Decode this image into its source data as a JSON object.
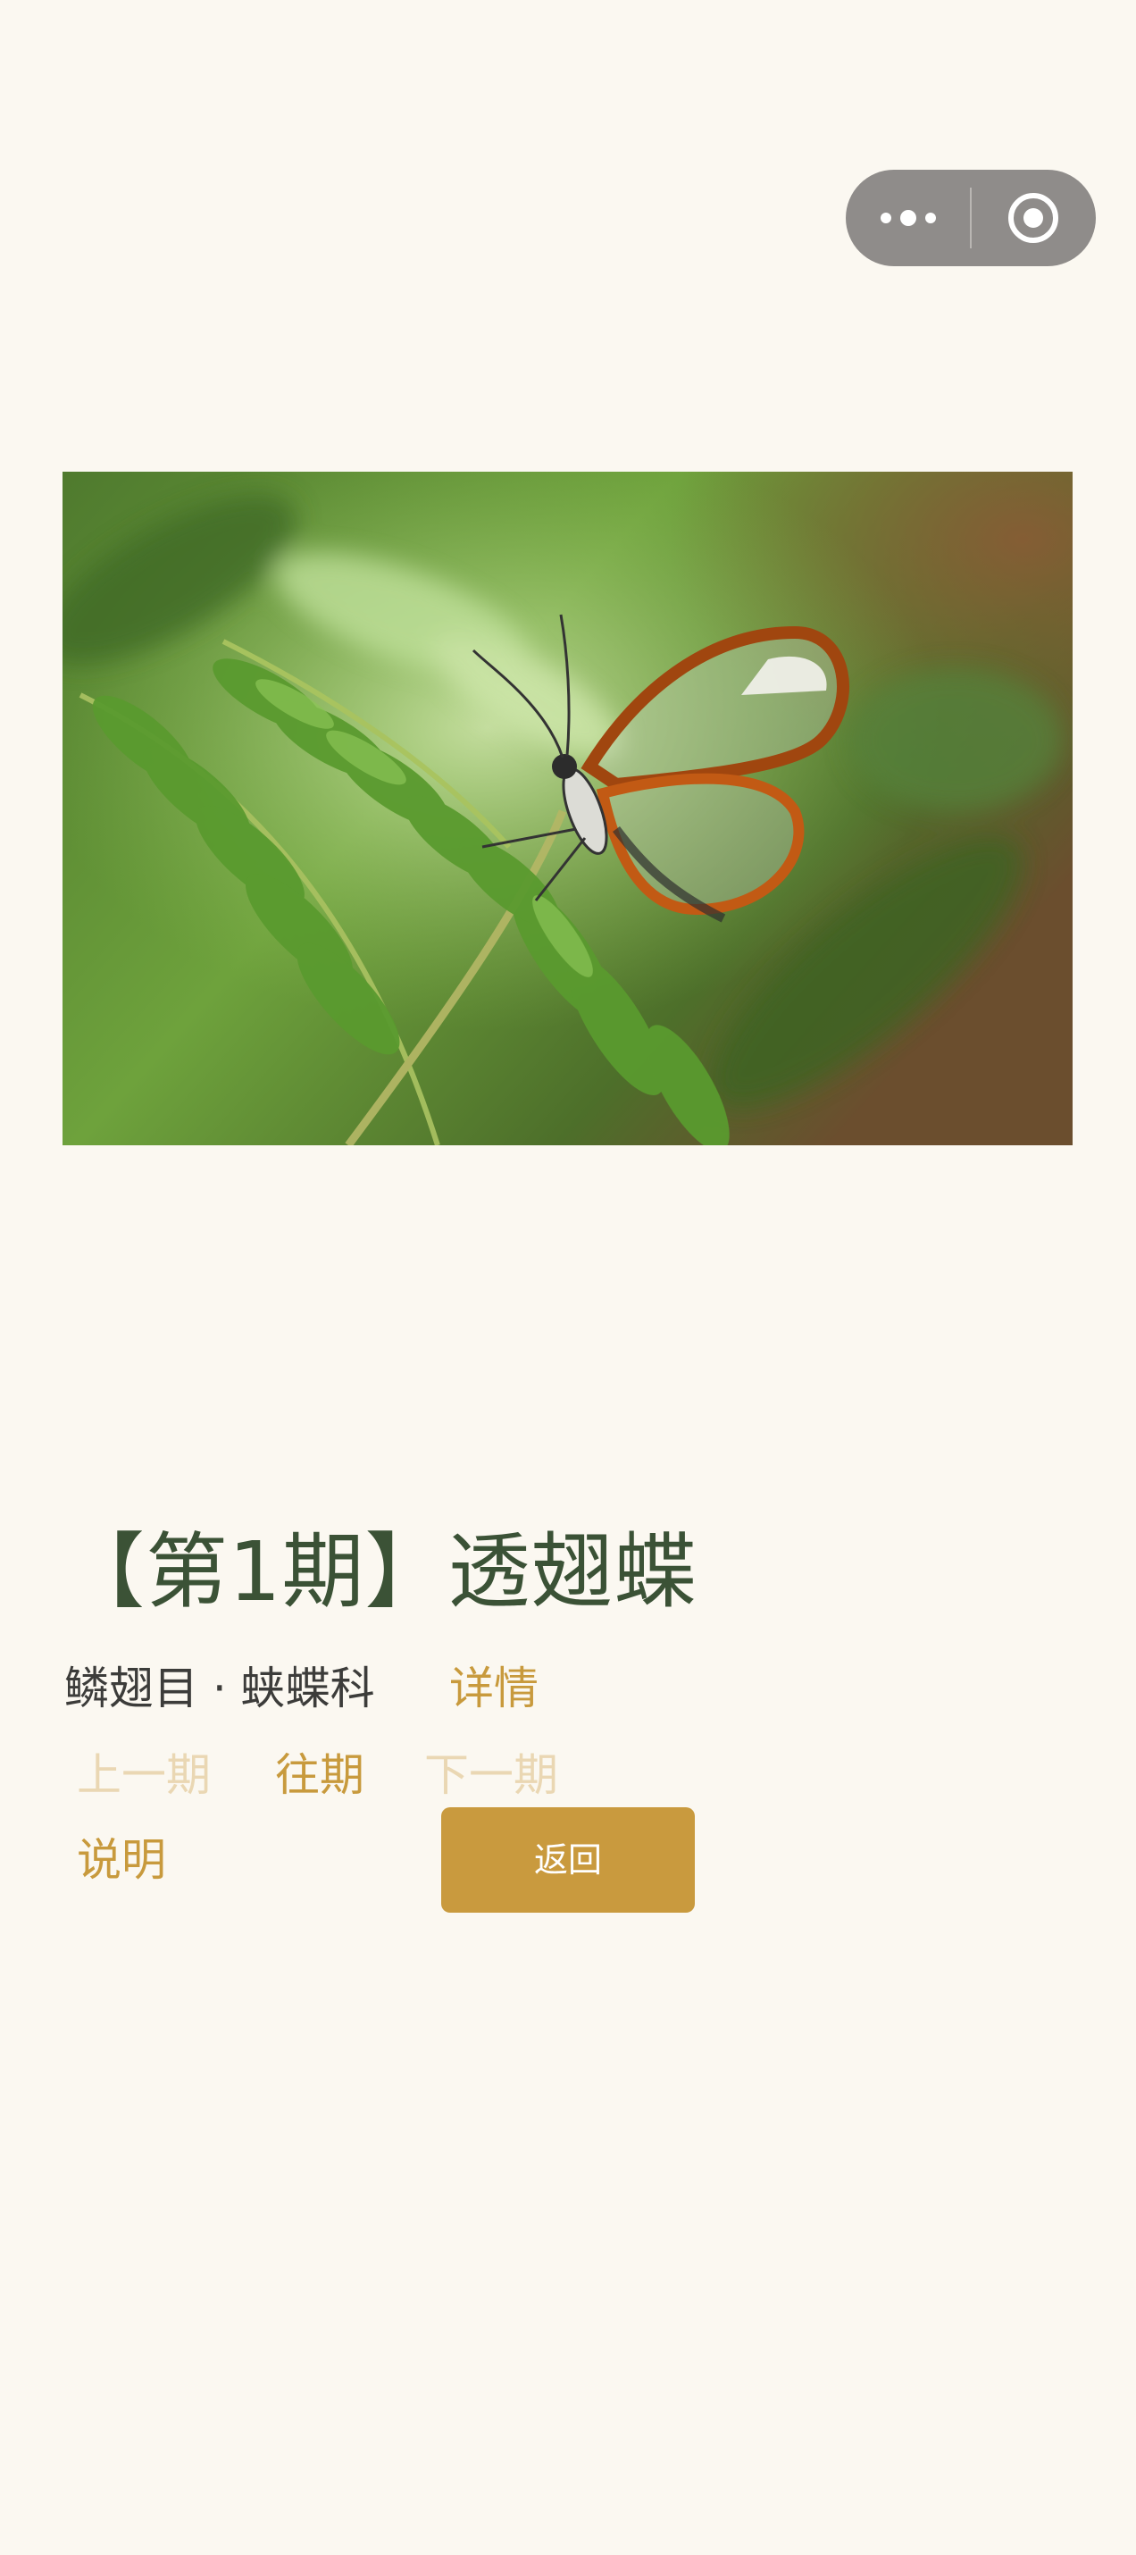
{
  "capsule": {
    "more_icon": "more-dots-icon",
    "close_icon": "record-circle-icon"
  },
  "photo": {
    "subject": "glasswing-butterfly-photo"
  },
  "issue": {
    "title": "【第1期】透翅蝶",
    "taxonomy": "鳞翅目 · 蛱蝶科",
    "detail_label": "详情"
  },
  "nav": {
    "prev_label": "上一期",
    "archive_label": "往期",
    "next_label": "下一期",
    "explain_label": "说明",
    "back_label": "返回"
  },
  "colors": {
    "background": "#fbf8f1",
    "title": "#3b5236",
    "accent": "#c89a3d",
    "disabled": "#ead7b3",
    "capsule": "#8f8c8a"
  }
}
